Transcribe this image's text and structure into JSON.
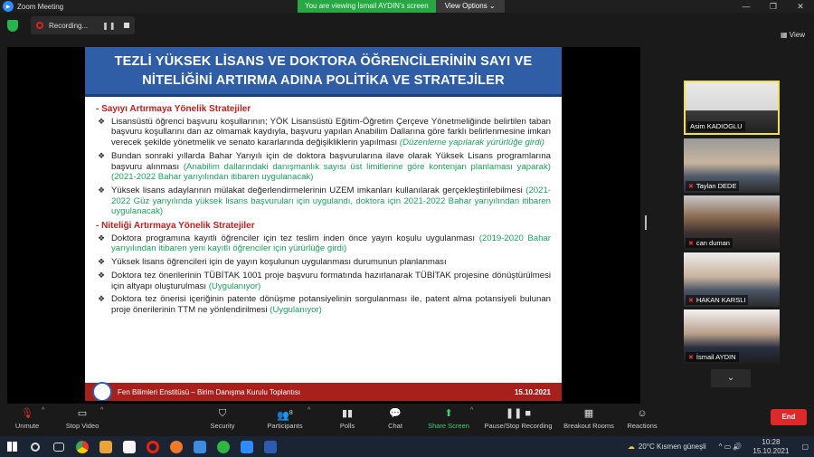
{
  "window": {
    "title": "Zoom Meeting",
    "viewing_banner": "You are viewing İsmail AYDIN's screen",
    "view_options": "View Options ⌄"
  },
  "recording": {
    "label": "Recording...",
    "pause": "❚❚",
    "stop": "■"
  },
  "view_button": "View",
  "slide": {
    "title_l1": "TEZLİ YÜKSEK LİSANS VE DOKTORA ÖĞRENCİLERİNİN SAYI VE",
    "title_l2": "NİTELİĞİNİ ARTIRMA ADINA POLİTİKA VE STRATEJİLER",
    "sec1": "- Sayıyı Artırmaya Yönelik Stratejiler",
    "s1i1": "Lisansüstü öğrenci başvuru koşullarının; YÖK Lisansüstü Eğitim-Öğretim Çerçeve Yönetmeliğinde belirtilen taban başvuru koşullarını dan az olmamak kaydıyla, başvuru yapılan Anabilim Dallarına göre farklı belirlenmesine imkan verecek şekilde yönetmelik ve senato kararlarında değişikliklerin yapılması",
    "s1i1g": "(Düzenleme yapılarak yürürlüğe girdi)",
    "s1i2": "Bundan sonraki yıllarda Bahar Yarıyılı için de doktora başvurularına ilave olarak Yüksek Lisans programlarına başvuru alınması",
    "s1i2g": "(Anabilim dallarındaki danışmanlık sayısı üst limitlerine göre kontenjan planlaması yaparak)",
    "s1i2g2": "(2021-2022 Bahar yarıyılından itibaren uygulanacak)",
    "s1i3": "Yüksek lisans adaylarının mülakat değerlendirmelerinin UZEM imkanları kullanılarak gerçekleştirilebilmesi",
    "s1i3g": "(2021-2022 Güz yarıyılında yüksek lisans başvuruları için uygulandı, doktora için 2021-2022 Bahar yarıyılından itibaren uygulanacak)",
    "sec2": "- Niteliği Artırmaya Yönelik Stratejiler",
    "s2i1": "Doktora programına kayıtlı öğrenciler için tez teslim inden önce yayın koşulu uygulanması",
    "s2i1g": "(2019-2020 Bahar yarıyılından itibaren yeni kayıtlı öğrenciler için yürürlüğe girdi)",
    "s2i2": "Yüksek lisans öğrencileri için de yayın koşulunun uygulanması durumunun planlanması",
    "s2i3": "Doktora tez önerilerinin TÜBİTAK 1001 proje başvuru formatında hazırlanarak TÜBİTAK projesine dönüştürülmesi için altyapı oluşturulması",
    "s2i3g": "(Uygulanıyor)",
    "s2i4": "Doktora tez önerisi içeriğinin patente dönüşme potansiyelinin sorgulanması ile, patent alma potansiyeli bulunan proje önerilerinin TTM ne yönlendirilmesi",
    "s2i4g": "(Uygulanıyor)",
    "footer": "Fen Bilimleri Enstitüsü – Birim Danışma Kurulu Toplantısı",
    "date": "15.10.2021"
  },
  "participants": [
    {
      "name": "Asim KADIOGLU",
      "muted": false
    },
    {
      "name": "Taylan DEDE",
      "muted": true
    },
    {
      "name": "can duman",
      "muted": true
    },
    {
      "name": "HAKAN KARSLI",
      "muted": true
    },
    {
      "name": "İsmail AYDIN",
      "muted": true
    }
  ],
  "toolbar": {
    "unmute": "Unmute",
    "stop_video": "Stop Video",
    "security": "Security",
    "participants": "Participants",
    "participant_count": "8",
    "polls": "Polls",
    "chat": "Chat",
    "share_screen": "Share Screen",
    "pause_rec": "Pause/Stop Recording",
    "breakout": "Breakout Rooms",
    "reactions": "Reactions",
    "end": "End"
  },
  "taskbar": {
    "weather": "20°C  Kısmen güneşli",
    "time": "10:28",
    "date": "15.10.2021"
  }
}
